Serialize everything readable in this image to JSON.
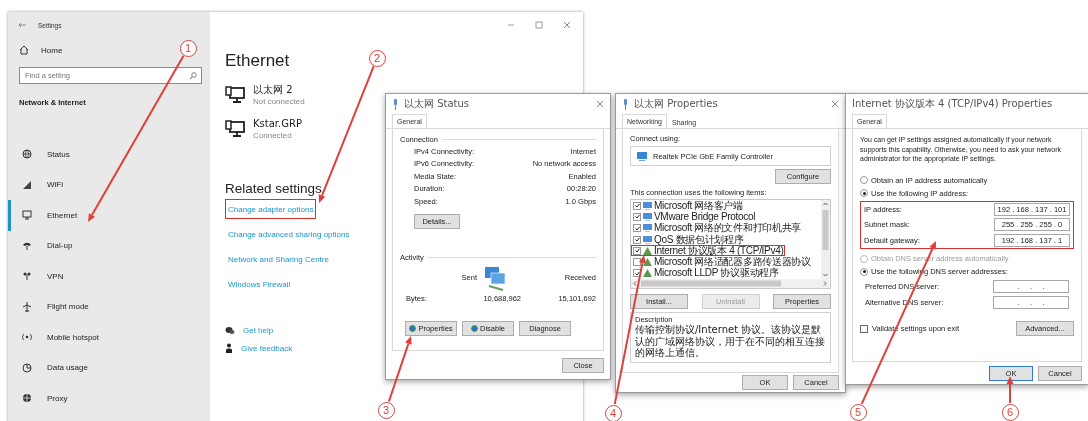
{
  "settings": {
    "title": "Settings",
    "home": "Home",
    "search": {
      "placeholder": "Find a setting"
    },
    "section": "Network & Internet",
    "items": [
      {
        "label": "Status",
        "selected": false
      },
      {
        "label": "WiFi",
        "selected": false
      },
      {
        "label": "Ethernet",
        "selected": true
      },
      {
        "label": "Dial-up",
        "selected": false
      },
      {
        "label": "VPN",
        "selected": false
      },
      {
        "label": "Flight mode",
        "selected": false
      },
      {
        "label": "Mobile hotspot",
        "selected": false
      },
      {
        "label": "Data usage",
        "selected": false
      },
      {
        "label": "Proxy",
        "selected": false
      }
    ],
    "heading": "Ethernet",
    "adapters": [
      {
        "name": "以太网 2",
        "status": "Not connected"
      },
      {
        "name": "Kstar.GRP",
        "status": "Connected"
      }
    ],
    "related_heading": "Related settings",
    "links": [
      {
        "label": "Change adapter options",
        "highlighted": true
      },
      {
        "label": "Change advanced sharing options",
        "highlighted": false
      },
      {
        "label": "Network and Sharing Centre",
        "highlighted": false
      },
      {
        "label": "Windows Firewall",
        "highlighted": false
      }
    ],
    "help_links": [
      "Get help",
      "Give feedback"
    ]
  },
  "status_dialog": {
    "title": "以太网 Status",
    "tabs": [
      {
        "label": "General",
        "selected": true
      }
    ],
    "connection_label": "Connection",
    "rows": [
      {
        "label": "IPv4 Connectivity:",
        "value": "Internet"
      },
      {
        "label": "IPv6 Connectivity:",
        "value": "No network access"
      },
      {
        "label": "Media State:",
        "value": "Enabled"
      },
      {
        "label": "Duration:",
        "value": "00:28:20"
      },
      {
        "label": "Speed:",
        "value": "1.0 Gbps"
      }
    ],
    "details_button": "Details...",
    "activity_label": "Activity",
    "sent": "Sent",
    "received": "Received",
    "bytes_label": "Bytes:",
    "bytes_sent": "10,688,962",
    "bytes_received": "15,101,692",
    "buttons": [
      "Properties",
      "Disable",
      "Diagnose"
    ],
    "close_button": "Close"
  },
  "properties_dialog": {
    "title": "以太网 Properties",
    "tabs": [
      {
        "label": "Networking",
        "selected": true
      },
      {
        "label": "Sharing",
        "selected": false
      }
    ],
    "connect_using": "Connect using:",
    "adapter": "Realtek PCIe GbE Family Controller",
    "configure_button": "Configure",
    "items_label": "This connection uses the following items:",
    "items": [
      {
        "label": "Microsoft 网络客户端",
        "checked": true,
        "highlighted": false
      },
      {
        "label": "VMware Bridge Protocol",
        "checked": true,
        "highlighted": false
      },
      {
        "label": "Microsoft 网络的文件和打印机共享",
        "checked": true,
        "highlighted": false
      },
      {
        "label": "QoS 数据包计划程序",
        "checked": true,
        "highlighted": false
      },
      {
        "label": "Internet 协议版本 4 (TCP/IPv4)",
        "checked": true,
        "highlighted": true
      },
      {
        "label": "Microsoft 网络适配器多路传送器协议",
        "checked": false,
        "highlighted": false
      },
      {
        "label": "Microsoft LLDP 协议驱动程序",
        "checked": true,
        "highlighted": false
      }
    ],
    "buttons": [
      {
        "label": "Install...",
        "disabled": false
      },
      {
        "label": "Uninstall",
        "disabled": true
      },
      {
        "label": "Properties",
        "disabled": false
      }
    ],
    "description_label": "Description",
    "description": "传输控制协议/Internet 协议。该协议是默认的广域网络协议，用于在不同的相互连接的网络上通信。",
    "ok_button": "OK",
    "cancel_button": "Cancel"
  },
  "ipv4_dialog": {
    "title": "Internet 协议版本 4 (TCP/IPv4) Properties",
    "tabs": [
      {
        "label": "General",
        "selected": true
      }
    ],
    "intro": "You can get IP settings assigned automatically if your network supports this capability. Otherwise, you need to ask your network administrator for the appropriate IP settings.",
    "ip_radios": [
      {
        "label": "Obtain an IP address automatically",
        "selected": false,
        "disabled": false
      },
      {
        "label": "Use the following IP address:",
        "selected": true,
        "disabled": false
      }
    ],
    "ip_fields_highlighted": true,
    "ip_fields": [
      {
        "label": "IP address:",
        "value": "192 . 168 . 137 . 101"
      },
      {
        "label": "Subnet mask:",
        "value": "255 . 255 . 255 . 0"
      },
      {
        "label": "Default gateway:",
        "value": "192 . 168 . 137 . 1"
      }
    ],
    "dns_radios": [
      {
        "label": "Obtain DNS server address automatically",
        "selected": false,
        "disabled": true
      },
      {
        "label": "Use the following DNS server addresses:",
        "selected": true,
        "disabled": false
      }
    ],
    "dns_fields": [
      {
        "label": "Preferred DNS server:",
        "value": ".     .     ."
      },
      {
        "label": "Alternative DNS server:",
        "value": ".     .     ."
      }
    ],
    "validate": {
      "label": "Validate settings upon exit",
      "checked": false
    },
    "advanced_button": "Advanced...",
    "buttons": [
      {
        "label": "OK",
        "default": true
      },
      {
        "label": "Cancel",
        "default": false
      }
    ]
  },
  "annotations": [
    {
      "number": "1"
    },
    {
      "number": "2"
    },
    {
      "number": "3"
    },
    {
      "number": "4"
    },
    {
      "number": "5"
    },
    {
      "number": "6"
    }
  ]
}
